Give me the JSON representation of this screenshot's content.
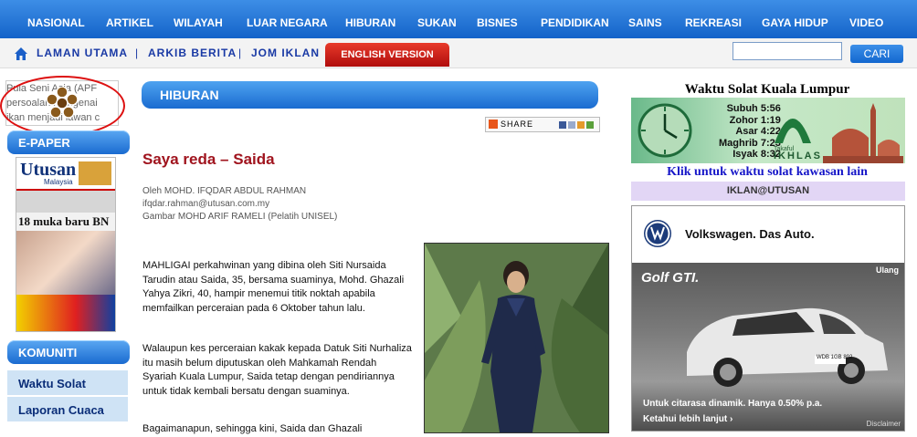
{
  "topnav": [
    "NASIONAL",
    "ARTIKEL",
    "WILAYAH",
    "LUAR NEGARA",
    "HIBURAN",
    "SUKAN",
    "BISNES",
    "PENDIDIKAN",
    "SAINS",
    "REKREASI",
    "GAYA HIDUP",
    "VIDEO"
  ],
  "subnav": {
    "laman": "LAMAN UTAMA",
    "arkib": "ARKIB BERITA",
    "jom": "JOM IKLAN",
    "sep": "|",
    "english": "ENGLISH VERSION"
  },
  "search": {
    "value": "",
    "button": "CARI"
  },
  "ticker": {
    "lines": [
      "Pula Seni Asia (APF",
      "persoalan mengenai",
      "ikan menjadi lawan c"
    ]
  },
  "left": {
    "epaper": "E-PAPER",
    "paper_name": "Utusan",
    "paper_sub": "Malaysia",
    "paper_headline": "18 muka baru BN",
    "komuniti": "KOMUNITI",
    "links": [
      "Waktu Solat",
      "Laporan Cuaca"
    ]
  },
  "section": "HIBURAN",
  "share": "SHARE",
  "article": {
    "title": "Saya reda – Saida",
    "byline": [
      "Oleh MOHD. IFQDAR ABDUL RAHMAN",
      "ifqdar.rahman@utusan.com.my",
      "Gambar MOHD ARIF RAMELI (Pelatih UNISEL)"
    ],
    "paragraphs": [
      "MAHLIGAI perkahwinan yang dibina oleh Siti Nursaida Tarudin atau Saida, 35, bersama suaminya, Mohd. Ghazali Yahya Zikri, 40, hampir menemui titik noktah apabila memfailkan perceraian pada 6 Oktober tahun lalu.",
      "Walaupun kes perceraian kakak kepada Datuk Siti Nurhaliza itu masih belum diputuskan oleh Mahkamah Rendah Syariah Kuala Lumpur, Saida tetap dengan pendiriannya untuk tidak kembali bersatu dengan suaminya.",
      "Bagaimanapun, sehingga kini, Saida dan Ghazali"
    ]
  },
  "solat": {
    "title": "Waktu Solat Kuala Lumpur",
    "times": [
      "Subuh 5:56",
      "Zohor 1:19",
      "Asar 4:22",
      "Maghrib 7:23",
      "Isyak 8:32"
    ],
    "brand": "IKHLAS",
    "brand_small": "Takaful",
    "klik": "Klik untuk waktu solat kawasan lain"
  },
  "iklan": "IKLAN@UTUSAN",
  "ad": {
    "brand": "Volkswagen. Das Auto.",
    "model": "Golf GTI.",
    "ulang": "Ulang",
    "plate": "WDB 1GB 802",
    "line1": "Untuk citarasa dinamik. Hanya 0.50% p.a.",
    "line2": "Ketahui lebih lanjut ›",
    "disclaimer": "Disclaimer"
  }
}
